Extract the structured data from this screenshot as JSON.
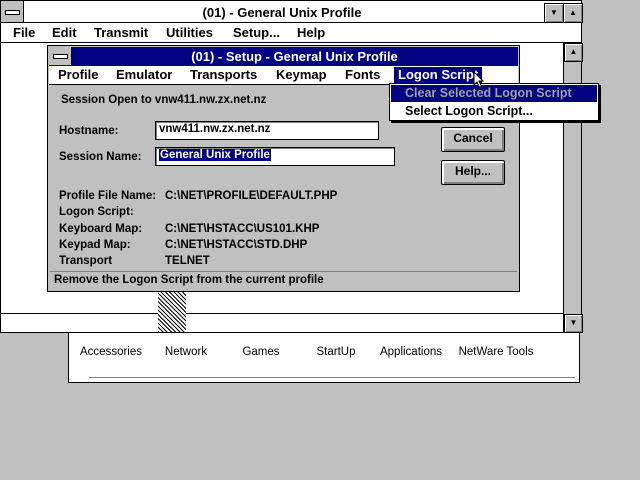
{
  "main_window": {
    "title": "(01) - General Unix Profile",
    "menu": [
      "File",
      "Edit",
      "Transmit",
      "Utilities",
      "Setup...",
      "Help"
    ]
  },
  "program_group": {
    "icons": [
      "Accessories",
      "Network",
      "Games",
      "StartUp",
      "Applications",
      "NetWare Tools"
    ]
  },
  "dialog": {
    "title": "(01) - Setup - General Unix Profile",
    "menu": [
      "Profile",
      "Emulator",
      "Transports",
      "Keymap",
      "Fonts",
      "Logon Script"
    ],
    "session_open": "Session Open to vnw411.nw.zx.net.nz",
    "hostname_label": "Hostname:",
    "hostname_value": "vnw411.nw.zx.net.nz",
    "session_name_label": "Session Name:",
    "session_name_value": "General Unix Profile",
    "cancel_label": "Cancel",
    "help_label": "Help...",
    "info": [
      {
        "label": "Profile File Name:",
        "value": "C:\\NET\\PROFILE\\DEFAULT.PHP"
      },
      {
        "label": "Logon Script:",
        "value": ""
      },
      {
        "label": "Keyboard Map:",
        "value": "C:\\NET\\HSTACC\\US101.KHP"
      },
      {
        "label": "Keypad Map:",
        "value": "C:\\NET\\HSTACC\\STD.DHP"
      },
      {
        "label": "Transport",
        "value": "TELNET"
      }
    ],
    "status": "Remove the Logon Script from the current profile"
  },
  "dropdown": {
    "items": [
      "Clear Selected Logon Script",
      "Select Logon Script..."
    ]
  },
  "colors": {
    "titlebar_active": "#000080",
    "face": "#c0c0c0"
  }
}
